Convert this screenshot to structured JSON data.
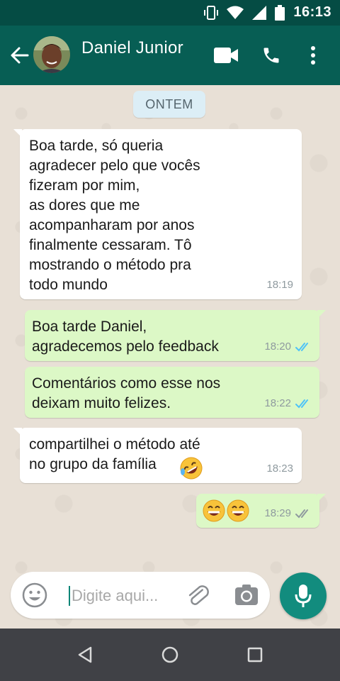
{
  "status_bar": {
    "time": "16:13",
    "icons": [
      "vibrate-icon",
      "wifi-icon",
      "signal-icon",
      "battery-icon"
    ]
  },
  "header": {
    "contact_name": "Daniel Junior",
    "actions": [
      "video-call-icon",
      "phone-call-icon",
      "more-vert-icon"
    ],
    "colors": {
      "status_bar": "#054c44",
      "app_bar": "#075e54"
    }
  },
  "chat": {
    "date_chip": "ONTEM",
    "messages": [
      {
        "direction": "in",
        "text": "Boa tarde, só queria\nagradecer pelo que vocês\nfizeram por mim,\nas dores que me\nacompanharam por anos\nfinalmente cessaram. Tô\nmostrando o método pra\ntodo mundo",
        "time": "18:19"
      },
      {
        "direction": "out",
        "text": "Boa tarde Daniel,\nagradecemos pelo feedback",
        "time": "18:20",
        "status": "read"
      },
      {
        "direction": "out",
        "text": "Comentários como esse nos\ndeixam muito felizes.",
        "time": "18:22",
        "status": "read"
      },
      {
        "direction": "in",
        "text": "compartilhei o método até\nno grupo da família",
        "emoji": "rolling-on-floor-laughing",
        "time": "18:23"
      },
      {
        "direction": "out",
        "emoji": [
          "grinning-face",
          "grinning-face"
        ],
        "time": "18:29",
        "status": "delivered"
      }
    ],
    "colors": {
      "incoming": "#ffffff",
      "outgoing": "#dcf8c6",
      "read_ticks": "#4fc3f7",
      "delivered_ticks": "#8f9a9f"
    }
  },
  "composer": {
    "placeholder": "Digite aqui...",
    "mic_color": "#128c7e"
  },
  "nav_bar": {
    "buttons": [
      "back-triangle-icon",
      "home-circle-icon",
      "recents-square-icon"
    ]
  }
}
